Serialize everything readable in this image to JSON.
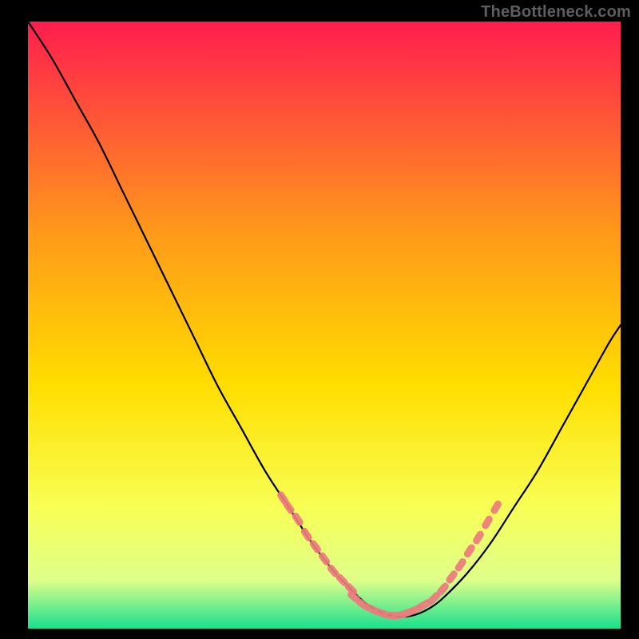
{
  "watermark": "TheBottleneck.com",
  "colors": {
    "page_bg": "#000000",
    "grad_top": "#ff1d4f",
    "grad_mid1": "#ff6a2a",
    "grad_mid2": "#ffde00",
    "grad_mid3": "#f8ff55",
    "grad_mid4": "#dfff8a",
    "grad_bottom": "#19e08f",
    "curve": "#000000",
    "marker": "#ed7b7d"
  },
  "chart_data": {
    "type": "line",
    "title": "",
    "xlabel": "",
    "ylabel": "",
    "xlim": [
      0,
      100
    ],
    "ylim": [
      0,
      100
    ],
    "legend": false,
    "grid": false,
    "series": [
      {
        "name": "bottleneck-curve",
        "x": [
          0,
          4,
          8,
          12,
          16,
          20,
          24,
          28,
          32,
          36,
          40,
          44,
          48,
          52,
          54,
          56,
          58,
          60,
          62,
          64,
          66,
          68,
          70,
          74,
          78,
          82,
          86,
          90,
          94,
          98,
          100
        ],
        "y": [
          100,
          94,
          87,
          80,
          72,
          64,
          56,
          48,
          40,
          33,
          26,
          20,
          14,
          9,
          7,
          5,
          3.5,
          2.5,
          2,
          2,
          2.5,
          3.5,
          5,
          9,
          14,
          20,
          26,
          33,
          40,
          47,
          50
        ]
      }
    ],
    "markers_left": {
      "name": "left-cluster",
      "x": [
        43,
        44,
        45.5,
        47,
        48.5,
        50,
        51.5,
        53,
        54.5
      ],
      "y": [
        21.5,
        20,
        18,
        15.5,
        13.5,
        11.5,
        9.5,
        8,
        6.5
      ]
    },
    "markers_bottom": {
      "name": "bottom-cluster",
      "x": [
        55,
        56.5,
        58,
        59.5,
        61,
        62.5,
        64,
        65.5,
        67
      ],
      "y": [
        5.2,
        4,
        3.2,
        2.6,
        2.2,
        2.2,
        2.6,
        3.2,
        4
      ]
    },
    "markers_right": {
      "name": "right-cluster",
      "x": [
        68.5,
        70,
        71.5,
        73,
        74.5,
        76,
        77.5,
        79
      ],
      "y": [
        5,
        6.5,
        8.5,
        10.5,
        12.8,
        15,
        17.5,
        20
      ]
    }
  }
}
